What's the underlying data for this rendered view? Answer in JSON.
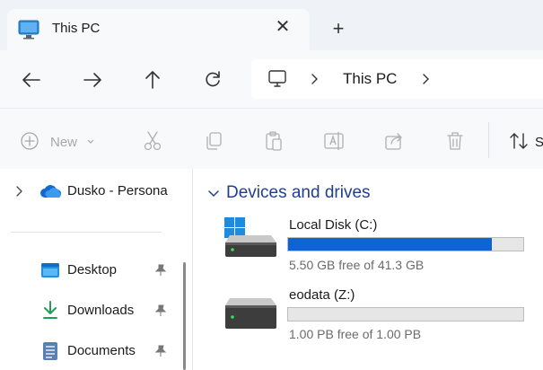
{
  "tab": {
    "title": "This PC",
    "close_glyph": "✕",
    "new_tab_glyph": "+",
    "icon": "monitor-icon"
  },
  "address": {
    "segments": [
      "This PC"
    ],
    "icon": "pc-icon"
  },
  "command_bar": {
    "new_label": "New",
    "sort_partial": "S"
  },
  "sidebar": {
    "onedrive": {
      "label": "Dusko - Persona",
      "icon": "onedrive-cloud-icon"
    },
    "quick_access": [
      {
        "label": "Desktop",
        "icon": "desktop-folder-icon"
      },
      {
        "label": "Downloads",
        "icon": "download-icon"
      },
      {
        "label": "Documents",
        "icon": "documents-icon"
      }
    ]
  },
  "main": {
    "section_title": "Devices and drives",
    "drives": [
      {
        "name": "Local Disk (C:)",
        "free_text": "5.50 GB free of 41.3 GB",
        "used_fraction": 0.867
      },
      {
        "name": "eodata (Z:)",
        "free_text": "1.00 PB free of 1.00 PB",
        "used_fraction": 0.0
      }
    ]
  },
  "colors": {
    "accent": "#0d64d2",
    "section_title": "#1f3f8f",
    "disabled": "#a8a8a8"
  }
}
